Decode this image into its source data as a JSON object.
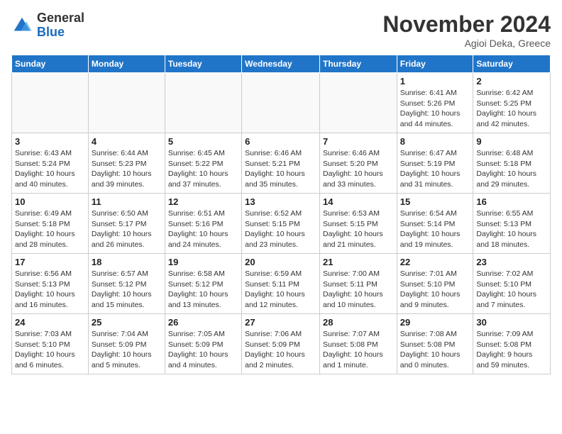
{
  "logo": {
    "general": "General",
    "blue": "Blue"
  },
  "header": {
    "month": "November 2024",
    "location": "Agioi Deka, Greece"
  },
  "days_of_week": [
    "Sunday",
    "Monday",
    "Tuesday",
    "Wednesday",
    "Thursday",
    "Friday",
    "Saturday"
  ],
  "weeks": [
    [
      {
        "day": "",
        "info": ""
      },
      {
        "day": "",
        "info": ""
      },
      {
        "day": "",
        "info": ""
      },
      {
        "day": "",
        "info": ""
      },
      {
        "day": "",
        "info": ""
      },
      {
        "day": "1",
        "info": "Sunrise: 6:41 AM\nSunset: 5:26 PM\nDaylight: 10 hours\nand 44 minutes."
      },
      {
        "day": "2",
        "info": "Sunrise: 6:42 AM\nSunset: 5:25 PM\nDaylight: 10 hours\nand 42 minutes."
      }
    ],
    [
      {
        "day": "3",
        "info": "Sunrise: 6:43 AM\nSunset: 5:24 PM\nDaylight: 10 hours\nand 40 minutes."
      },
      {
        "day": "4",
        "info": "Sunrise: 6:44 AM\nSunset: 5:23 PM\nDaylight: 10 hours\nand 39 minutes."
      },
      {
        "day": "5",
        "info": "Sunrise: 6:45 AM\nSunset: 5:22 PM\nDaylight: 10 hours\nand 37 minutes."
      },
      {
        "day": "6",
        "info": "Sunrise: 6:46 AM\nSunset: 5:21 PM\nDaylight: 10 hours\nand 35 minutes."
      },
      {
        "day": "7",
        "info": "Sunrise: 6:46 AM\nSunset: 5:20 PM\nDaylight: 10 hours\nand 33 minutes."
      },
      {
        "day": "8",
        "info": "Sunrise: 6:47 AM\nSunset: 5:19 PM\nDaylight: 10 hours\nand 31 minutes."
      },
      {
        "day": "9",
        "info": "Sunrise: 6:48 AM\nSunset: 5:18 PM\nDaylight: 10 hours\nand 29 minutes."
      }
    ],
    [
      {
        "day": "10",
        "info": "Sunrise: 6:49 AM\nSunset: 5:18 PM\nDaylight: 10 hours\nand 28 minutes."
      },
      {
        "day": "11",
        "info": "Sunrise: 6:50 AM\nSunset: 5:17 PM\nDaylight: 10 hours\nand 26 minutes."
      },
      {
        "day": "12",
        "info": "Sunrise: 6:51 AM\nSunset: 5:16 PM\nDaylight: 10 hours\nand 24 minutes."
      },
      {
        "day": "13",
        "info": "Sunrise: 6:52 AM\nSunset: 5:15 PM\nDaylight: 10 hours\nand 23 minutes."
      },
      {
        "day": "14",
        "info": "Sunrise: 6:53 AM\nSunset: 5:15 PM\nDaylight: 10 hours\nand 21 minutes."
      },
      {
        "day": "15",
        "info": "Sunrise: 6:54 AM\nSunset: 5:14 PM\nDaylight: 10 hours\nand 19 minutes."
      },
      {
        "day": "16",
        "info": "Sunrise: 6:55 AM\nSunset: 5:13 PM\nDaylight: 10 hours\nand 18 minutes."
      }
    ],
    [
      {
        "day": "17",
        "info": "Sunrise: 6:56 AM\nSunset: 5:13 PM\nDaylight: 10 hours\nand 16 minutes."
      },
      {
        "day": "18",
        "info": "Sunrise: 6:57 AM\nSunset: 5:12 PM\nDaylight: 10 hours\nand 15 minutes."
      },
      {
        "day": "19",
        "info": "Sunrise: 6:58 AM\nSunset: 5:12 PM\nDaylight: 10 hours\nand 13 minutes."
      },
      {
        "day": "20",
        "info": "Sunrise: 6:59 AM\nSunset: 5:11 PM\nDaylight: 10 hours\nand 12 minutes."
      },
      {
        "day": "21",
        "info": "Sunrise: 7:00 AM\nSunset: 5:11 PM\nDaylight: 10 hours\nand 10 minutes."
      },
      {
        "day": "22",
        "info": "Sunrise: 7:01 AM\nSunset: 5:10 PM\nDaylight: 10 hours\nand 9 minutes."
      },
      {
        "day": "23",
        "info": "Sunrise: 7:02 AM\nSunset: 5:10 PM\nDaylight: 10 hours\nand 7 minutes."
      }
    ],
    [
      {
        "day": "24",
        "info": "Sunrise: 7:03 AM\nSunset: 5:10 PM\nDaylight: 10 hours\nand 6 minutes."
      },
      {
        "day": "25",
        "info": "Sunrise: 7:04 AM\nSunset: 5:09 PM\nDaylight: 10 hours\nand 5 minutes."
      },
      {
        "day": "26",
        "info": "Sunrise: 7:05 AM\nSunset: 5:09 PM\nDaylight: 10 hours\nand 4 minutes."
      },
      {
        "day": "27",
        "info": "Sunrise: 7:06 AM\nSunset: 5:09 PM\nDaylight: 10 hours\nand 2 minutes."
      },
      {
        "day": "28",
        "info": "Sunrise: 7:07 AM\nSunset: 5:08 PM\nDaylight: 10 hours\nand 1 minute."
      },
      {
        "day": "29",
        "info": "Sunrise: 7:08 AM\nSunset: 5:08 PM\nDaylight: 10 hours\nand 0 minutes."
      },
      {
        "day": "30",
        "info": "Sunrise: 7:09 AM\nSunset: 5:08 PM\nDaylight: 9 hours\nand 59 minutes."
      }
    ]
  ]
}
